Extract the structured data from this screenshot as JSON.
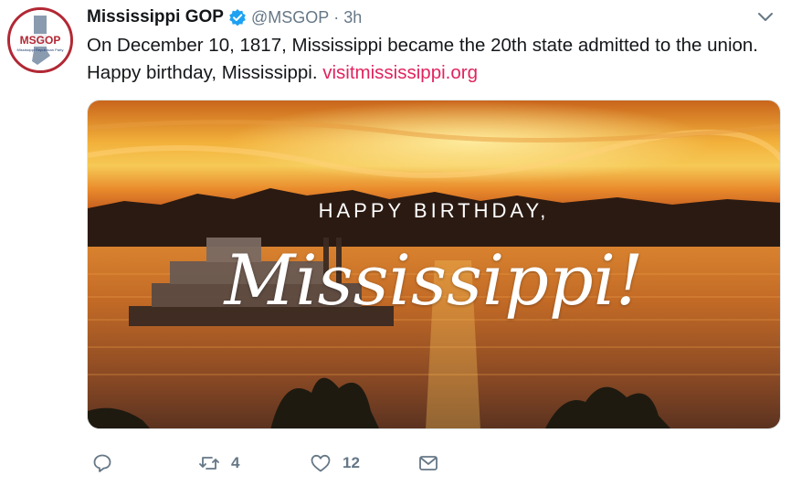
{
  "tweet": {
    "author_name": "Mississippi GOP",
    "handle": "@MSGOP",
    "separator": "·",
    "time": "3h",
    "text": "On December 10, 1817, Mississippi became the 20th state admitted to the union. Happy birthday, Mississippi. ",
    "link_text": "visitmississippi.org"
  },
  "avatar": {
    "logo_text": "MSGOP",
    "subtext": "Mississippi Republican Party"
  },
  "media": {
    "line1": "HAPPY BIRTHDAY,",
    "line2": "Mississippi!"
  },
  "actions": {
    "retweet_count": "4",
    "like_count": "12"
  },
  "colors": {
    "link": "#e0245e",
    "muted": "#657786",
    "verified": "#1da1f2",
    "brand_red": "#b22834"
  }
}
